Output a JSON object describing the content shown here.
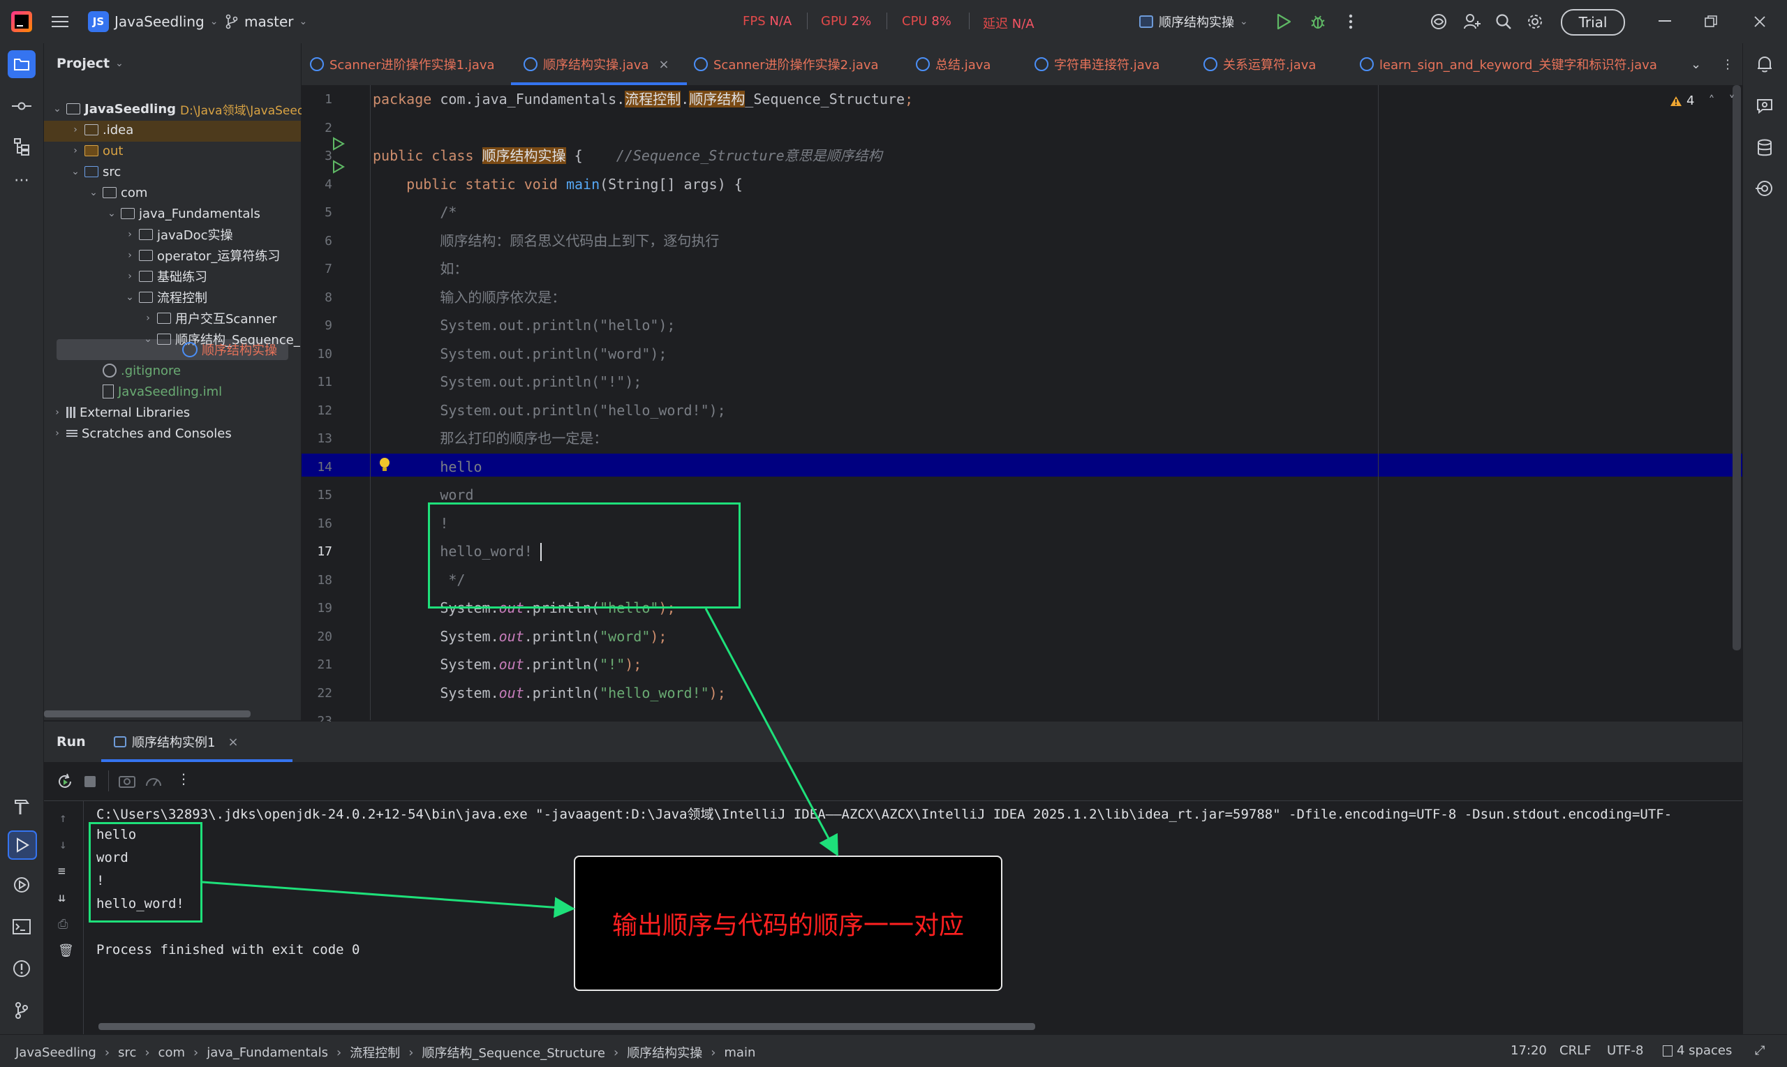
{
  "titlebar": {
    "project_badge": "JS",
    "project_name": "JavaSeedling",
    "branch": "master",
    "fps_label": "FPS",
    "fps_value": "N/A",
    "gpu_label": "GPU",
    "gpu_value": "2%",
    "cpu_label": "CPU",
    "cpu_value": "8%",
    "latency_label": "延迟",
    "latency_value": "N/A",
    "run_config": "顺序结构实操",
    "trial_label": "Trial"
  },
  "project_panel": {
    "title": "Project",
    "tree": [
      {
        "label": "JavaSeedling",
        "extra": "D:\\Java领域\\JavaSeed",
        "kind": "module"
      },
      {
        "label": ".idea",
        "kind": "folder"
      },
      {
        "label": "out",
        "kind": "folder-excluded"
      },
      {
        "label": "src",
        "kind": "folder"
      },
      {
        "label": "com",
        "kind": "package"
      },
      {
        "label": "java_Fundamentals",
        "kind": "package"
      },
      {
        "label": "javaDoc实操",
        "kind": "package"
      },
      {
        "label": "operator_运算符练习",
        "kind": "package"
      },
      {
        "label": "基础练习",
        "kind": "package"
      },
      {
        "label": "流程控制",
        "kind": "package"
      },
      {
        "label": "用户交互Scanner",
        "kind": "package"
      },
      {
        "label": "顺序结构_Sequence_",
        "kind": "package"
      },
      {
        "label": "顺序结构实操",
        "kind": "class"
      },
      {
        "label": ".gitignore",
        "kind": "file"
      },
      {
        "label": "JavaSeedling.iml",
        "kind": "file"
      },
      {
        "label": "External Libraries",
        "kind": "libs"
      },
      {
        "label": "Scratches and Consoles",
        "kind": "scratches"
      }
    ]
  },
  "editor_tabs": [
    {
      "label": "Scanner进阶操作实操1.java",
      "active": false
    },
    {
      "label": "顺序结构实操.java",
      "active": true
    },
    {
      "label": "Scanner进阶操作实操2.java",
      "active": false
    },
    {
      "label": "总结.java",
      "active": false
    },
    {
      "label": "字符串连接符.java",
      "active": false
    },
    {
      "label": "关系运算符.java",
      "active": false
    },
    {
      "label": "learn_sign_and_keyword_关键字和标识符.java",
      "active": false
    }
  ],
  "editor": {
    "warnings": "4",
    "current_line": "17",
    "lines": [
      [
        {
          "t": "package ",
          "c": "kw"
        },
        {
          "t": "com.java_Fundamentals.",
          "c": "pl"
        },
        {
          "t": "流程控制",
          "c": "hl"
        },
        {
          "t": ".",
          "c": "pl"
        },
        {
          "t": "顺序结构",
          "c": "hl"
        },
        {
          "t": "_Sequence_Structure",
          "c": "pl"
        },
        {
          "t": ";",
          "c": "kw"
        }
      ],
      [],
      [
        {
          "t": "public class ",
          "c": "kw"
        },
        {
          "t": "顺序结构实操",
          "c": "hl"
        },
        {
          "t": " {    ",
          "c": "pl"
        },
        {
          "t": "//Sequence_Structure意思是顺序结构",
          "c": "cm"
        }
      ],
      [
        {
          "t": "    public static void ",
          "c": "kw"
        },
        {
          "t": "main",
          "c": "fn"
        },
        {
          "t": "(String[] args) {",
          "c": "pl"
        }
      ],
      [
        {
          "t": "        /*",
          "c": "cm"
        }
      ],
      [
        {
          "t": "        顺序结构：顾名思义代码由上到下，逐句执行",
          "c": "cm"
        }
      ],
      [
        {
          "t": "        如：",
          "c": "cm"
        }
      ],
      [
        {
          "t": "        输入的顺序依次是：",
          "c": "cm"
        }
      ],
      [
        {
          "t": "        System.out.println(\"hello\");",
          "c": "cm"
        }
      ],
      [
        {
          "t": "        System.out.println(\"word\");",
          "c": "cm"
        }
      ],
      [
        {
          "t": "        System.out.println(\"!\");",
          "c": "cm"
        }
      ],
      [
        {
          "t": "        System.out.println(\"hello_word!\");",
          "c": "cm"
        }
      ],
      [
        {
          "t": "        那么打印的顺序也一定是：",
          "c": "cm"
        }
      ],
      [
        {
          "t": "        hello",
          "c": "cm"
        }
      ],
      [
        {
          "t": "        word",
          "c": "cm"
        }
      ],
      [
        {
          "t": "        !",
          "c": "cm"
        }
      ],
      [
        {
          "t": "        hello_word!",
          "c": "cm"
        }
      ],
      [
        {
          "t": "         */",
          "c": "cm"
        }
      ],
      [
        {
          "t": "        System.",
          "c": "pl"
        },
        {
          "t": "out",
          "c": "st"
        },
        {
          "t": ".println(",
          "c": "pl"
        },
        {
          "t": "\"hello\"",
          "c": "str"
        },
        {
          "t": ");",
          "c": "kw"
        }
      ],
      [
        {
          "t": "        System.",
          "c": "pl"
        },
        {
          "t": "out",
          "c": "st"
        },
        {
          "t": ".println(",
          "c": "pl"
        },
        {
          "t": "\"word\"",
          "c": "str"
        },
        {
          "t": ");",
          "c": "kw"
        }
      ],
      [
        {
          "t": "        System.",
          "c": "pl"
        },
        {
          "t": "out",
          "c": "st"
        },
        {
          "t": ".println(",
          "c": "pl"
        },
        {
          "t": "\"!\"",
          "c": "str"
        },
        {
          "t": ");",
          "c": "kw"
        }
      ],
      [
        {
          "t": "        System.",
          "c": "pl"
        },
        {
          "t": "out",
          "c": "st"
        },
        {
          "t": ".println(",
          "c": "pl"
        },
        {
          "t": "\"hello_word!\"",
          "c": "str"
        },
        {
          "t": ");",
          "c": "kw"
        }
      ],
      [],
      [
        {
          "t": "    }",
          "c": "pl"
        }
      ],
      [
        {
          "t": "}",
          "c": "pl"
        }
      ],
      []
    ]
  },
  "run_panel": {
    "title": "Run",
    "tab_label": "顺序结构实例1",
    "command": "C:\\Users\\32893\\.jdks\\openjdk-24.0.2+12-54\\bin\\java.exe \"-javaagent:D:\\Java领域\\IntelliJ IDEA——AZCX\\AZCX\\IntelliJ IDEA 2025.1.2\\lib\\idea_rt.jar=59788\" -Dfile.encoding=UTF-8 -Dsun.stdout.encoding=UTF-",
    "output": [
      "hello",
      "word",
      "!",
      "hello_word!"
    ],
    "exit_message": "Process finished with exit code 0"
  },
  "annotation": {
    "callout_text": "输出顺序与代码的顺序一一对应"
  },
  "statusbar": {
    "breadcrumb": [
      "JavaSeedling",
      "src",
      "com",
      "java_Fundamentals",
      "流程控制",
      "顺序结构_Sequence_Structure",
      "顺序结构实操",
      "main"
    ],
    "position": "17:20",
    "line_sep": "CRLF",
    "encoding": "UTF-8",
    "indent": "4 spaces"
  },
  "colors": {
    "keyword": "#cf8e6d",
    "string": "#6aab73",
    "comment": "#7a7e85",
    "function": "#56a8f5",
    "static_field": "#c77dbb",
    "plain": "#bcbec4",
    "annotation_green": "#1ee07a",
    "callout_red": "#ff2020"
  }
}
